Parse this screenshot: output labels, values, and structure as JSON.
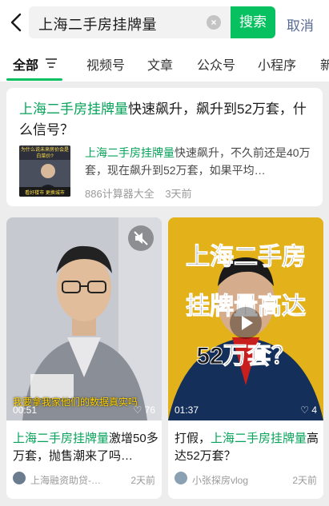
{
  "search": {
    "query": "上海二手房挂牌量",
    "button_label": "搜索",
    "cancel_label": "取消"
  },
  "tabs": [
    "全部",
    "视频号",
    "文章",
    "公众号",
    "小程序",
    "新"
  ],
  "article": {
    "title_highlight": "上海二手房挂牌量",
    "title_rest": "快速飙升，飙升到52万套，什么信号？",
    "snippet_highlight": "上海二手房挂牌量",
    "snippet_rest": "快速飙升，不久前还是40万套，现在飙升到52万套，如果平均…",
    "source": "886计算器大全",
    "time": "3天前",
    "thumb_text_top": "为什么说未来房价会是白菜价?",
    "thumb_text_bottom": "看好楼市 更换城市"
  },
  "videos": [
    {
      "duration": "00:51",
      "likes": "76",
      "caption": "我要拿我家他们的数据真实吗",
      "title_highlight": "上海二手房挂牌量",
      "title_rest": "激增50多万套，抛售潮来了吗…",
      "source": "上海融资助贷-…",
      "time": "2天前"
    },
    {
      "duration": "01:37",
      "likes": "4",
      "overlay_line1": "上海二手房",
      "overlay_line2": "挂牌量高达",
      "overlay_line3": "52万套？",
      "title_prefix": "打假，",
      "title_highlight": "上海二手房挂牌量",
      "title_rest": "高达52万套？",
      "source": "小张探房vlog",
      "time": "2天前"
    }
  ],
  "colors": {
    "accent": "#07c160",
    "highlight": "#07a35a",
    "link": "#576b95"
  }
}
